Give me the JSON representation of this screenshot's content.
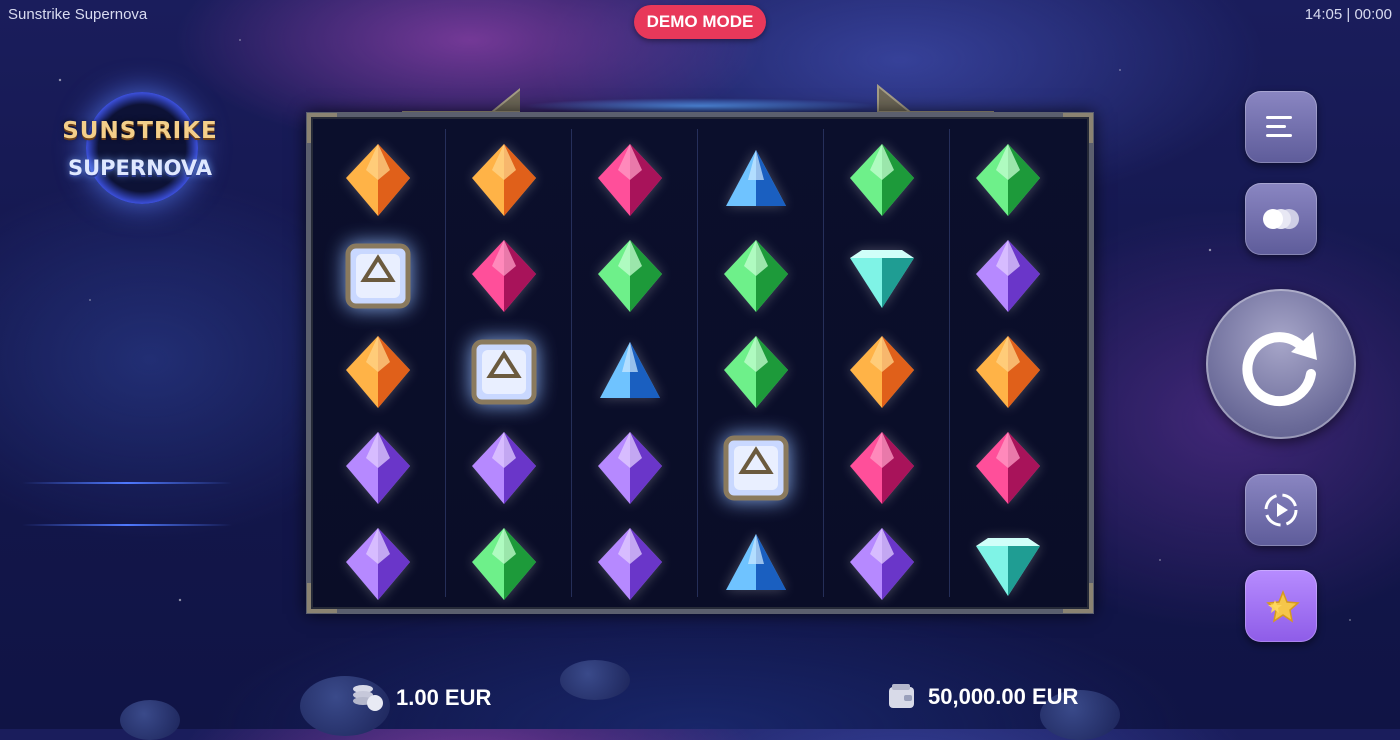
{
  "header": {
    "game_title": "Sunstrike Supernova",
    "demo_badge": "DEMO MODE",
    "clock": "14:05 | 00:00"
  },
  "logo": {
    "line1": "SUNSTRIKE",
    "line2": "SUPERNOVA"
  },
  "grid": {
    "columns": 6,
    "rows": 5,
    "symbols": [
      [
        "orange-gem",
        "orange-gem",
        "pink-gem",
        "blue-pyramid",
        "green-gem",
        "green-gem"
      ],
      [
        "crystal-cube",
        "pink-gem",
        "green-gem",
        "green-gem",
        "teal-gem",
        "purple-gem"
      ],
      [
        "orange-gem",
        "crystal-cube",
        "blue-pyramid",
        "green-gem",
        "orange-gem",
        "orange-gem"
      ],
      [
        "purple-gem",
        "purple-gem",
        "purple-gem",
        "crystal-cube",
        "pink-gem",
        "pink-gem"
      ],
      [
        "purple-gem",
        "green-gem",
        "purple-gem",
        "blue-pyramid",
        "purple-gem",
        "teal-gem"
      ]
    ]
  },
  "controls": {
    "menu_icon": "menu-icon",
    "coins_icon": "coins-icon",
    "spin_icon": "spin-icon",
    "autoplay_icon": "autoplay-icon",
    "favorites_icon": "star-icon"
  },
  "footer": {
    "bet": "1.00 EUR",
    "balance": "50,000.00 EUR",
    "bet_icon": "coin-stack-icon",
    "balance_icon": "wallet-icon"
  },
  "colors": {
    "demo_badge": "#e8385a",
    "button": "#7472b0",
    "favorites_button": "#a274f6"
  }
}
